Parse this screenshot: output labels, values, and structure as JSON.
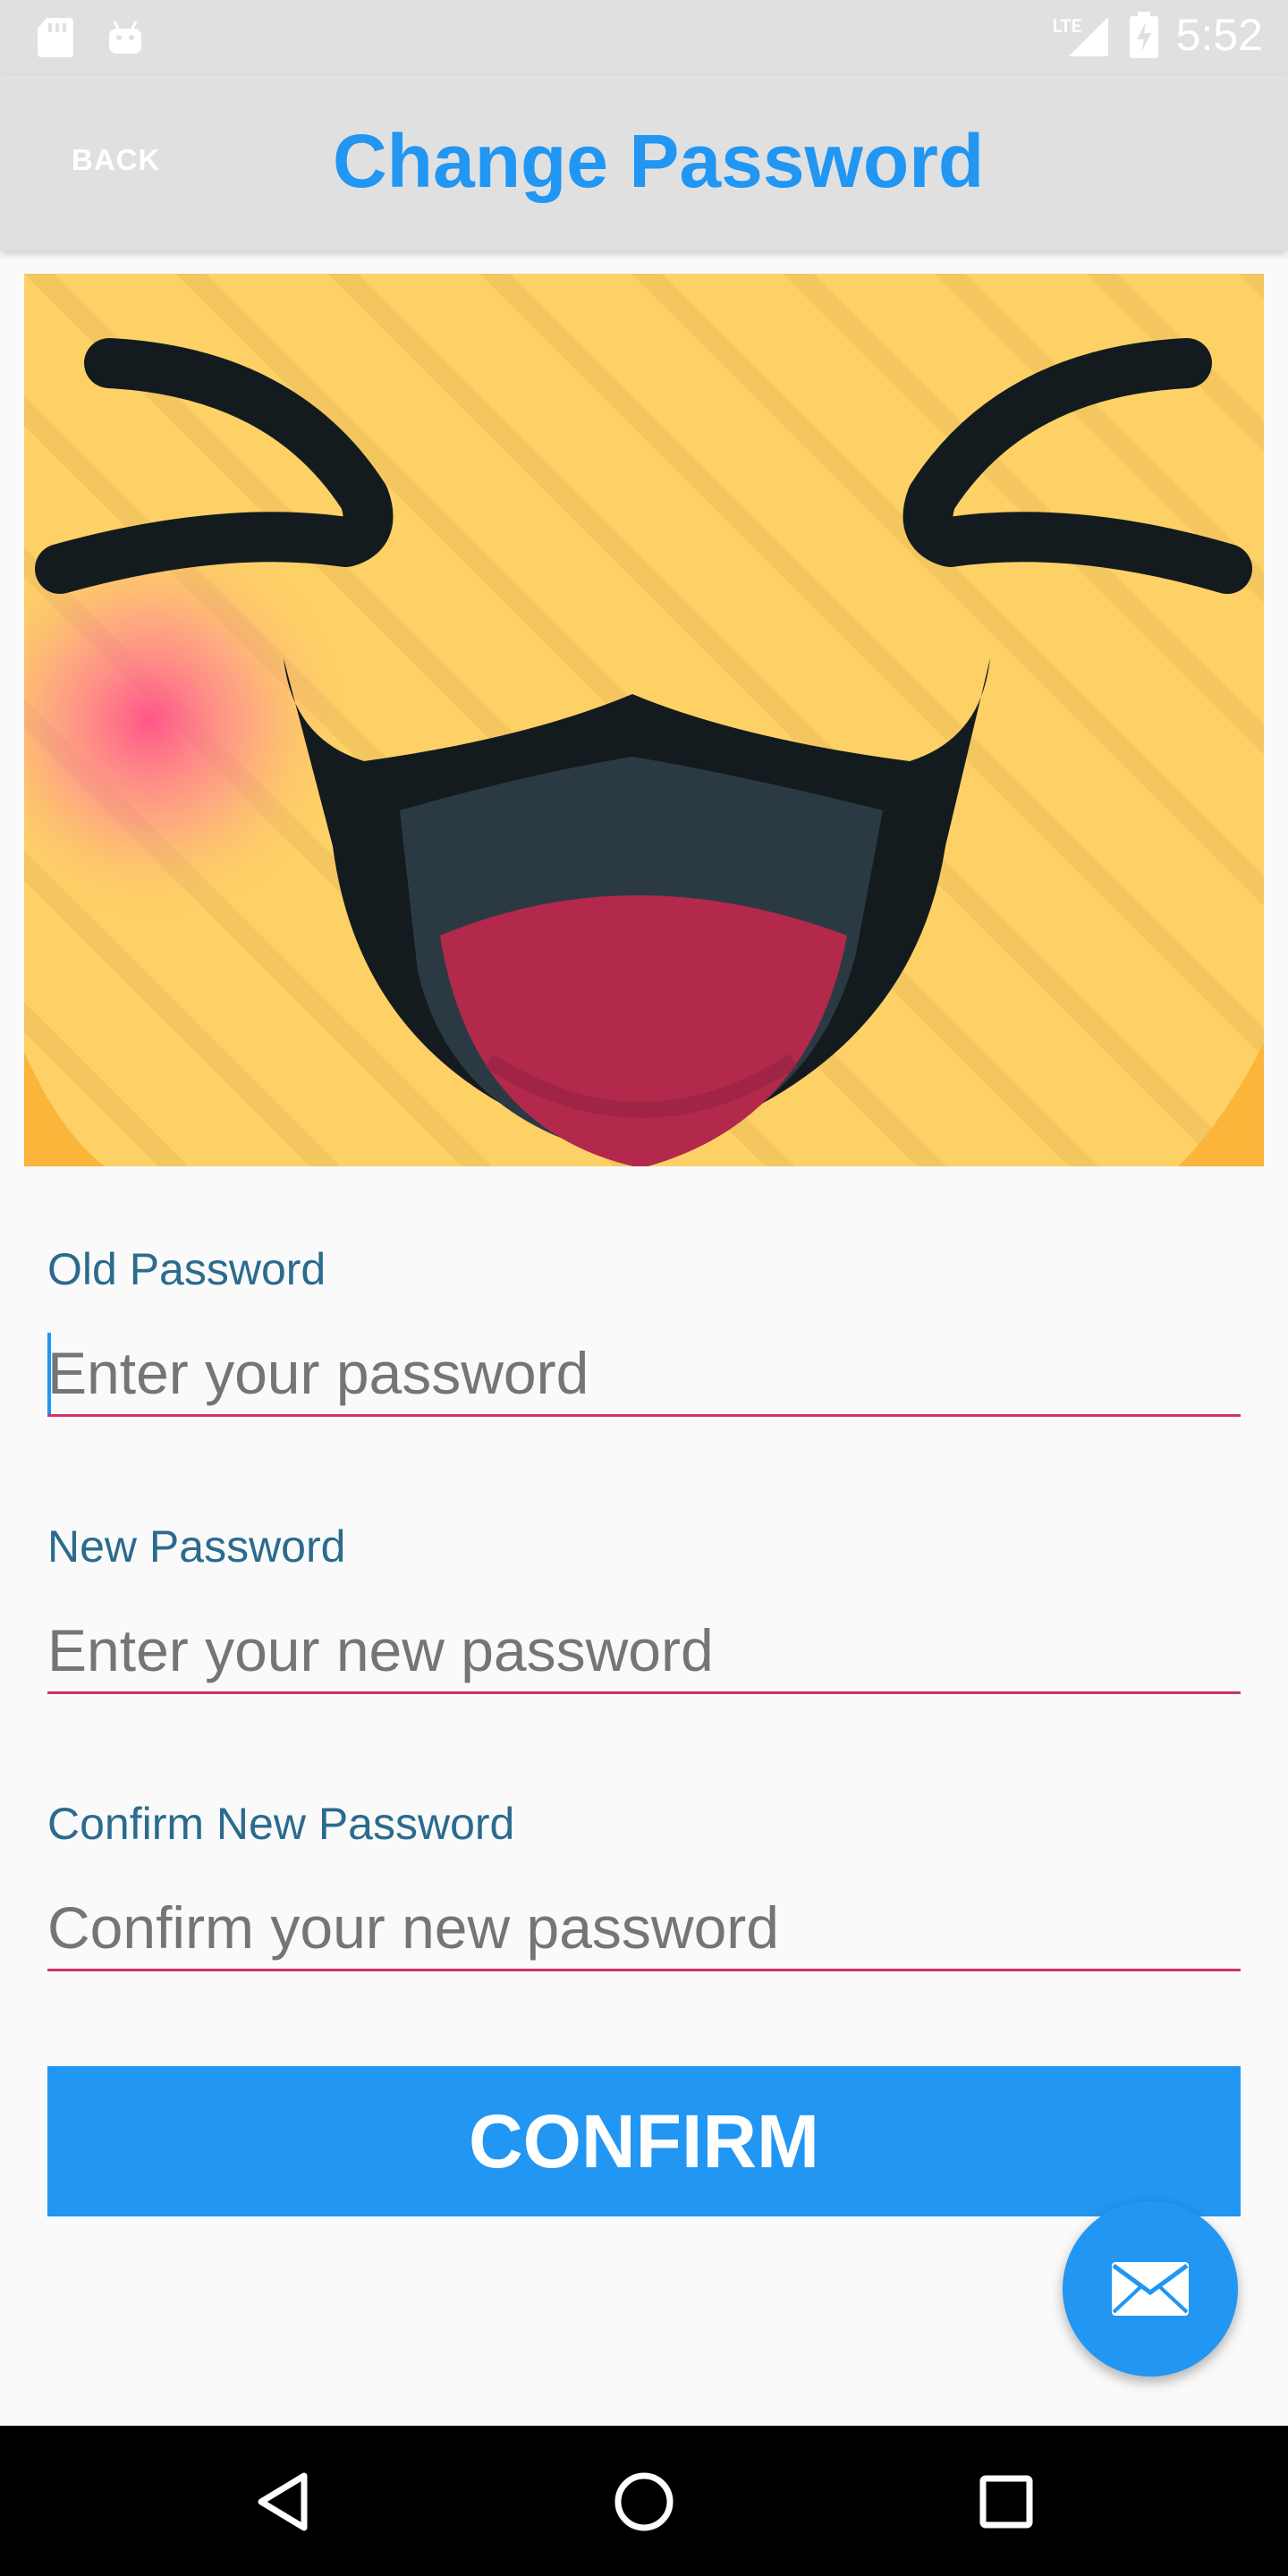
{
  "status_bar": {
    "time": "5:52",
    "network": "LTE"
  },
  "toolbar": {
    "back_label": "BACK",
    "title": "Change Password"
  },
  "form": {
    "old_password": {
      "label": "Old Password",
      "placeholder": "Enter your password"
    },
    "new_password": {
      "label": "New Password",
      "placeholder": "Enter your new password"
    },
    "confirm_password": {
      "label": "Confirm New Password",
      "placeholder": "Confirm your new password"
    },
    "confirm_label": "CONFIRM"
  },
  "icons": {
    "fab": "mail-icon",
    "nav": [
      "back-triangle-icon",
      "home-circle-icon",
      "recents-square-icon"
    ]
  },
  "colors": {
    "accent": "#2196f3",
    "underline": "#d0336c",
    "label": "#2a6b8e",
    "toolbar_bg": "#e0e0e0"
  }
}
